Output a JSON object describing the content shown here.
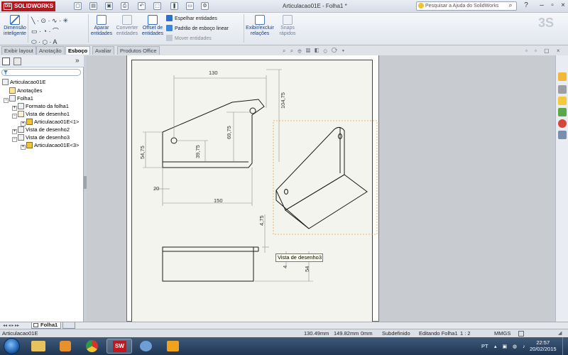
{
  "window": {
    "app_name": "SOLIDWORKS",
    "title": "Articulacao01E - Folha1 *",
    "search_placeholder": "Pesquisar a Ajuda do SolidWorks"
  },
  "ribbon": {
    "smart_dimension": "Dimensão\ninteligente",
    "trim": "Aparar\nentidades",
    "convert": "Converter\nentidades",
    "offset": "Offset de\nentidades",
    "mirror": "Espelhar entidades",
    "pattern": "Padrão de esboço linear",
    "move": "Mover entidades",
    "relations": "Exibir/excluir\nrelações",
    "snaps": "Snaps\nrápidos"
  },
  "tabs": [
    "Exibir layout",
    "Anotação",
    "Esboço",
    "Avaliar",
    "Produtos Office"
  ],
  "active_tab": "Esboço",
  "tree": {
    "root": "Articulacao01E",
    "items": [
      "Anotações",
      "Folha1",
      "Formato da folha1",
      "Vista de desenho1",
      "Articulacao01E<1>",
      "Vista de desenho2",
      "Vista de desenho3",
      "Articulacao01E<3>"
    ]
  },
  "drawing": {
    "dims": {
      "d130": "130",
      "d104": "104,75",
      "d69": "69,75",
      "d54": "54,75",
      "d39": "39,75",
      "d20": "20",
      "d150": "150",
      "d4": "4,75",
      "d4b": "4",
      "d54b": "54"
    },
    "tooltip": "Vista de desenho3"
  },
  "sheet_tab": "Folha1",
  "status": {
    "name": "Articulacao01E",
    "x": "130.49mm",
    "y": "149.82mm",
    "z": "0mm",
    "state": "Subdefinido",
    "editing": "Editando Folha1",
    "scale": "1 : 2",
    "units": "MMGS"
  },
  "taskbar": {
    "lang": "PT",
    "time": "22:57",
    "date": "20/02/2015"
  },
  "colors": {
    "accent": "#b5171f",
    "selection": "#e8a13a"
  }
}
